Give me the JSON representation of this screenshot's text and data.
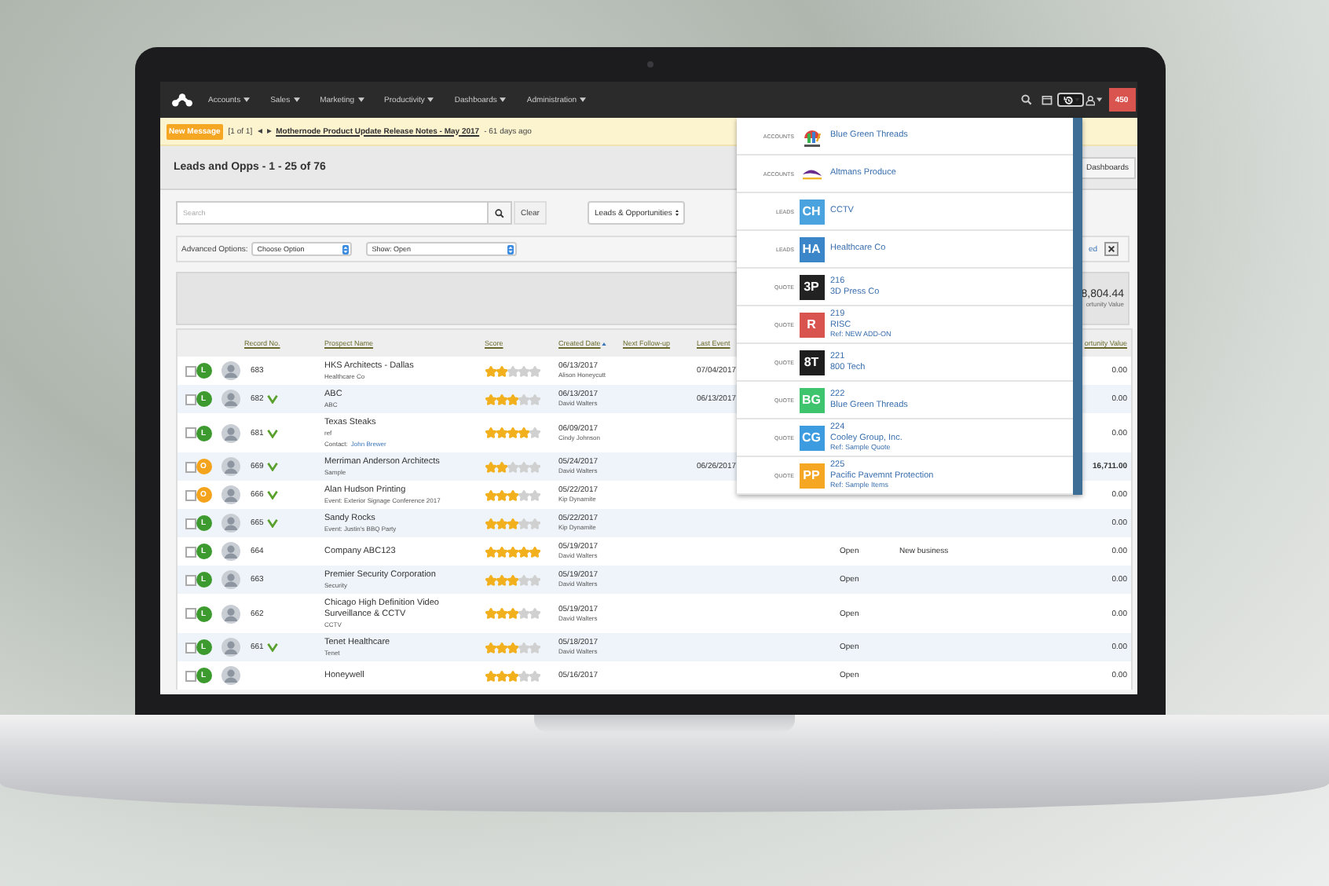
{
  "nav": {
    "items": [
      {
        "label": "Accounts"
      },
      {
        "label": "Sales"
      },
      {
        "label": "Marketing"
      },
      {
        "label": "Productivity"
      },
      {
        "label": "Dashboards"
      },
      {
        "label": "Administration"
      }
    ],
    "tools": [
      {
        "kind": "search",
        "selected": false
      },
      {
        "kind": "calendar",
        "selected": false
      },
      {
        "kind": "history",
        "selected": true
      },
      {
        "kind": "user",
        "selected": false
      }
    ],
    "badge": "450"
  },
  "message_bar": {
    "badge": "New Message",
    "counter": "[1 of 1]",
    "link": "Mothernode Product Update Release Notes - May 2017",
    "age": "- 61 days ago"
  },
  "header": {
    "title": "Leads and Opps - 1 - 25 of 76",
    "button": "Dashboards"
  },
  "search": {
    "placeholder": "Search",
    "clear": "Clear",
    "list_select": "Leads & Opportunities"
  },
  "options": {
    "label": "Advanced Options:",
    "option_select": "Choose Option",
    "show_select": "Show: Open",
    "partial_text": "ed"
  },
  "summary": {
    "value": "8,804.44",
    "label": "ortunity Value"
  },
  "table": {
    "columns": [
      {
        "label": "Record No.",
        "sorted": false
      },
      {
        "label": "Prospect Name",
        "sorted": false
      },
      {
        "label": "Score",
        "sorted": false
      },
      {
        "label": "Created Date",
        "sorted": true
      },
      {
        "label": "Next Follow-up",
        "sorted": false
      },
      {
        "label": "Last Event",
        "sorted": false
      },
      {
        "label": "ortunity Value",
        "sorted": false
      }
    ],
    "rows": [
      {
        "checked": false,
        "stage": "L",
        "color": "#3c9a2e",
        "record": "683",
        "verified": false,
        "name": "HKS Architects - Dallas",
        "sub": "Healthcare Co",
        "stars": 2,
        "created": "06/13/2017",
        "owner": "Alison Honeycutt",
        "last_event": "07/04/2017",
        "value": "0.00",
        "bold_value": false
      },
      {
        "checked": false,
        "stage": "L",
        "color": "#3c9a2e",
        "record": "682",
        "verified": true,
        "name": "ABC",
        "sub": "ABC",
        "stars": 3,
        "created": "06/13/2017",
        "owner": "David Walters",
        "last_event": "06/13/2017",
        "value": "0.00",
        "bold_value": false
      },
      {
        "checked": false,
        "stage": "L",
        "color": "#3c9a2e",
        "record": "681",
        "verified": true,
        "name": "Texas Steaks",
        "sub": "ref",
        "contact_label": "Contact:",
        "contact": "John Brewer",
        "stars": 4,
        "created": "06/09/2017",
        "owner": "Cindy Johnson",
        "value": "0.00",
        "bold_value": false
      },
      {
        "checked": false,
        "stage": "O",
        "color": "#f4a31c",
        "record": "669",
        "verified": true,
        "name": "Merriman Anderson Architects",
        "sub": "Sample",
        "stars": 2,
        "created": "05/24/2017",
        "owner": "David Walters",
        "last_event": "06/26/2017",
        "value": "16,711.00",
        "bold_value": true
      },
      {
        "checked": false,
        "stage": "O",
        "color": "#f4a31c",
        "record": "666",
        "verified": true,
        "name": "Alan Hudson Printing",
        "sub": "Event: Exterior Signage Conference 2017",
        "stars": 3,
        "created": "05/22/2017",
        "owner": "Kip Dynamite",
        "value": "0.00",
        "bold_value": false
      },
      {
        "checked": false,
        "stage": "L",
        "color": "#3c9a2e",
        "record": "665",
        "verified": true,
        "name": "Sandy Rocks",
        "sub": "Event: Justin's BBQ Party",
        "stars": 3,
        "created": "05/22/2017",
        "owner": "Kip Dynamite",
        "value": "0.00",
        "bold_value": false
      },
      {
        "checked": false,
        "stage": "L",
        "color": "#3c9a2e",
        "record": "664",
        "verified": false,
        "name": "Company ABC123",
        "stars": 5,
        "created": "05/19/2017",
        "owner": "David Walters",
        "status": "Open",
        "note": "New business",
        "value": "0.00",
        "bold_value": false
      },
      {
        "checked": false,
        "stage": "L",
        "color": "#3c9a2e",
        "record": "663",
        "verified": false,
        "name": "Premier Security Corporation",
        "sub": "Security",
        "stars": 3,
        "created": "05/19/2017",
        "owner": "David Walters",
        "status": "Open",
        "value": "0.00",
        "bold_value": false
      },
      {
        "checked": false,
        "stage": "L",
        "color": "#3c9a2e",
        "record": "662",
        "verified": false,
        "name": "Chicago High Definition Video Surveillance & CCTV",
        "sub": "CCTV",
        "stars": 3,
        "created": "05/19/2017",
        "owner": "David Walters",
        "status": "Open",
        "value": "0.00",
        "bold_value": false
      },
      {
        "checked": false,
        "stage": "L",
        "color": "#3c9a2e",
        "record": "661",
        "verified": true,
        "name": "Tenet Healthcare",
        "sub": "Tenet",
        "stars": 3,
        "created": "05/18/2017",
        "owner": "David Walters",
        "status": "Open",
        "value": "0.00",
        "bold_value": false
      },
      {
        "checked": false,
        "stage": "L",
        "color": "#3c9a2e",
        "verified": false,
        "name": "Honeywell",
        "stars": 3,
        "created": "05/16/2017",
        "status": "Open",
        "value": "0.00",
        "bold_value": false
      }
    ]
  },
  "history_menu": {
    "items": [
      {
        "category": "ACCOUNTS",
        "kind": "logo",
        "lines": [
          "Blue Green Threads"
        ]
      },
      {
        "category": "ACCOUNTS",
        "kind": "logo",
        "lines": [
          "Altmans Produce"
        ]
      },
      {
        "category": "LEADS",
        "kind": "initials",
        "initials": "CH",
        "color": "#4aa3df",
        "lines": [
          "CCTV"
        ]
      },
      {
        "category": "LEADS",
        "kind": "initials",
        "initials": "HA",
        "color": "#3a86c8",
        "lines": [
          "Healthcare Co"
        ]
      },
      {
        "category": "QUOTE",
        "kind": "initials",
        "initials": "3P",
        "color": "#222222",
        "lines": [
          "216",
          "3D Press Co"
        ]
      },
      {
        "category": "QUOTE",
        "kind": "initials",
        "initials": "R",
        "color": "#d9534f",
        "lines": [
          "219",
          "RISC",
          "Ref: NEW ADD-ON"
        ]
      },
      {
        "category": "QUOTE",
        "kind": "initials",
        "initials": "8T",
        "color": "#1e1e1e",
        "lines": [
          "221",
          "800 Tech"
        ]
      },
      {
        "category": "QUOTE",
        "kind": "initials",
        "initials": "BG",
        "color": "#3ec46d",
        "lines": [
          "222",
          "Blue Green Threads"
        ]
      },
      {
        "category": "QUOTE",
        "kind": "initials",
        "initials": "CG",
        "color": "#3d9be0",
        "lines": [
          "224",
          "Cooley Group, Inc.",
          "Ref: Sample Quote"
        ]
      },
      {
        "category": "QUOTE",
        "kind": "initials",
        "initials": "PP",
        "color": "#f5a623",
        "lines": [
          "225",
          "Pacific Pavemnt Protection",
          "Ref: Sample Items"
        ]
      }
    ]
  }
}
